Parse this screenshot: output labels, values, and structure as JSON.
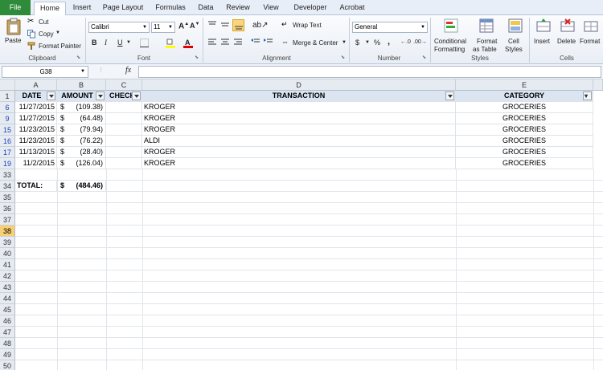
{
  "ribbon_tabs": [
    "File",
    "Home",
    "Insert",
    "Page Layout",
    "Formulas",
    "Data",
    "Review",
    "View",
    "Developer",
    "Acrobat"
  ],
  "clipboard": {
    "paste": "Paste",
    "cut": "Cut",
    "copy": "Copy",
    "format_painter": "Format Painter",
    "label": "Clipboard"
  },
  "font": {
    "name": "Calibri",
    "size": "11",
    "label": "Font"
  },
  "alignment": {
    "wrap": "Wrap Text",
    "merge": "Merge & Center",
    "label": "Alignment"
  },
  "number": {
    "format": "General",
    "dollar": "$",
    "percent": "%",
    "comma": ",",
    "label": "Number"
  },
  "styles": {
    "conditional": "Conditional",
    "conditional2": "Formatting",
    "format_table": "Format",
    "format_table2": "as Table",
    "cell_styles": "Cell",
    "cell_styles2": "Styles",
    "label": "Styles"
  },
  "cells": {
    "insert": "Insert",
    "delete": "Delete",
    "format": "Format",
    "label": "Cells"
  },
  "formula_bar": {
    "name_box": "G38",
    "fx": "fx",
    "formula": ""
  },
  "columns": [
    "A",
    "B",
    "C",
    "D",
    "E"
  ],
  "header_row": {
    "row": "1",
    "date": "DATE",
    "amount": "AMOUNT",
    "check": "CHECK",
    "transaction": "TRANSACTION",
    "category": "CATEGORY"
  },
  "rows": [
    {
      "row": "6",
      "date": "11/27/2015",
      "cur": "$",
      "amount": "(109.38)",
      "transaction": "KROGER",
      "category": "GROCERIES"
    },
    {
      "row": "9",
      "date": "11/27/2015",
      "cur": "$",
      "amount": "(64.48)",
      "transaction": "KROGER",
      "category": "GROCERIES"
    },
    {
      "row": "15",
      "date": "11/23/2015",
      "cur": "$",
      "amount": "(79.94)",
      "transaction": "KROGER",
      "category": "GROCERIES"
    },
    {
      "row": "16",
      "date": "11/23/2015",
      "cur": "$",
      "amount": "(76.22)",
      "transaction": "ALDI",
      "category": "GROCERIES"
    },
    {
      "row": "17",
      "date": "11/13/2015",
      "cur": "$",
      "amount": "(28.40)",
      "transaction": "KROGER",
      "category": "GROCERIES"
    },
    {
      "row": "19",
      "date": "11/2/2015",
      "cur": "$",
      "amount": "(126.04)",
      "transaction": "KROGER",
      "category": "GROCERIES"
    }
  ],
  "blank_row_33": "33",
  "total_row": {
    "row": "34",
    "label": "TOTAL:",
    "cur": "$",
    "amount": "(484.46)"
  },
  "empty_rows": [
    "35",
    "36",
    "37",
    "38",
    "39",
    "40",
    "41",
    "42",
    "43",
    "44",
    "45",
    "46",
    "47",
    "48",
    "49",
    "50"
  ],
  "selected_row": "38"
}
